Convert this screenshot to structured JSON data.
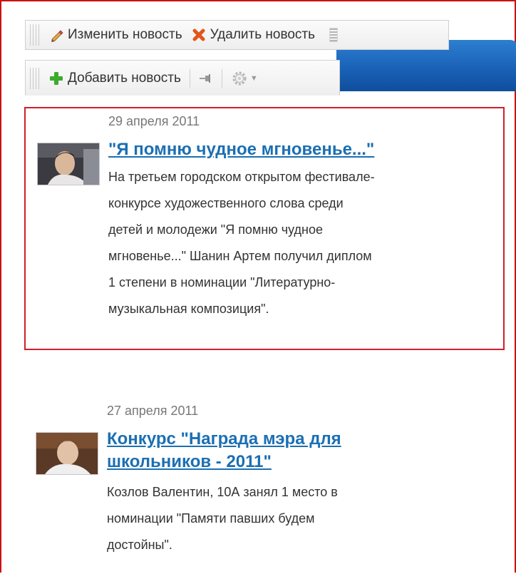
{
  "toolbar_top": {
    "edit_label": "Изменить новость",
    "delete_label": "Удалить новость"
  },
  "toolbar_bottom": {
    "add_label": "Добавить новость"
  },
  "news": [
    {
      "date": "29 апреля 2011",
      "title": "\"Я помню чудное мгновенье...\"",
      "text_lines": [
        "На третьем городском открытом фестивале-",
        "конкурсе художественного слова среди",
        "детей и молодежи \"Я помню чудное",
        "мгновенье...\" Шанин Артем получил диплом",
        "1 степени в номинации \"Литературно-",
        "музыкальная композиция\"."
      ]
    },
    {
      "date": "27 апреля 2011",
      "title_lines": [
        "Конкурс \"Награда мэра для",
        "школьников - 2011\""
      ],
      "text_lines": [
        "Козлов Валентин, 10А занял 1 место в",
        "номинации \"Памяти павших будем",
        "достойны\"."
      ]
    }
  ],
  "colors": {
    "selection_border": "#d0202b",
    "link": "#1b6fb3",
    "header_blue": "#1a62b8"
  },
  "icons": {
    "edit": "pencil-icon",
    "delete": "red-x-icon",
    "add": "green-plus-icon",
    "pin": "pin-icon",
    "settings": "gear-icon"
  }
}
